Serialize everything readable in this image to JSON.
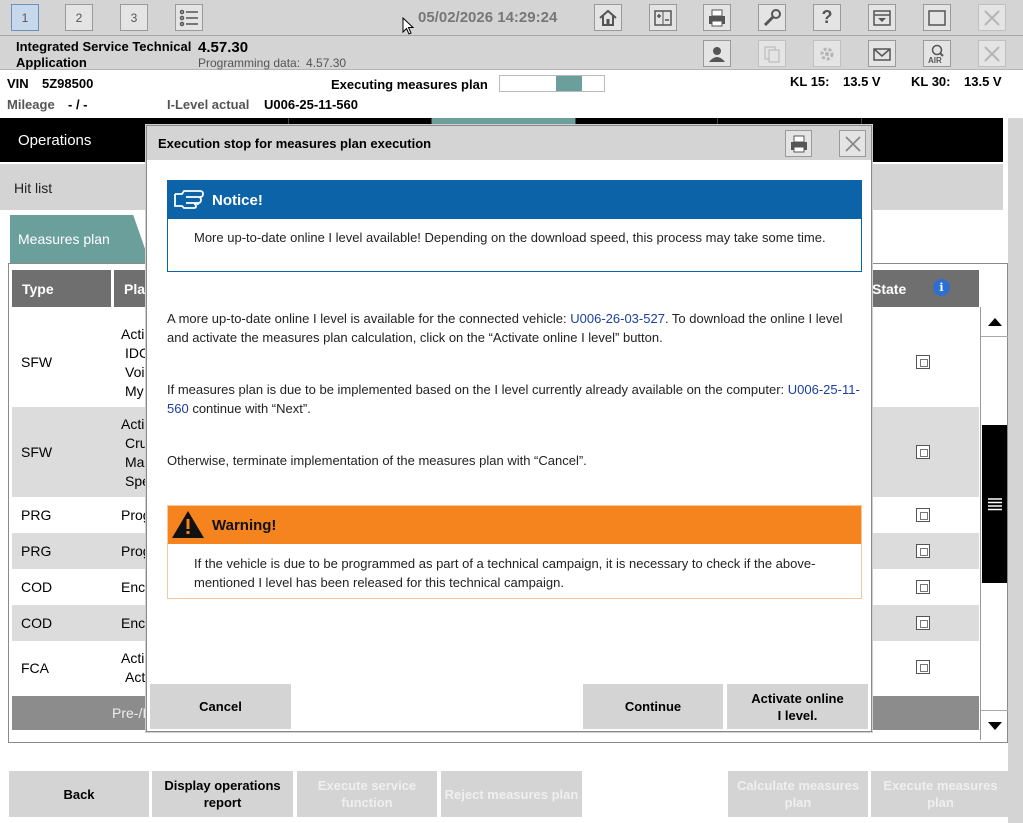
{
  "toolbar": {
    "tab1": "1",
    "tab2": "2",
    "tab3": "3",
    "datetime": "05/02/2026 14:29:24"
  },
  "header": {
    "app_name": "Integrated Service Technical Application",
    "version": "4.57.30",
    "programming_data_label": "Programming data:",
    "programming_data_value": "4.57.30"
  },
  "vehicle": {
    "vin_label": "VIN",
    "vin": "5Z98500",
    "mileage_label": "Mileage",
    "mileage": "- / -",
    "ilevel_label": "I-Level actual",
    "ilevel": "U006-25-11-560",
    "executing_label": "Executing measures plan",
    "kl15_label": "KL 15:",
    "kl15": "13.5 V",
    "kl30_label": "KL 30:",
    "kl30": "13.5 V"
  },
  "nav": {
    "operations": "Operations",
    "hit_list": "Hit list",
    "measures_plan": "Measures plan"
  },
  "table": {
    "columns": {
      "type": "Type",
      "plan": "Pla",
      "state": "State"
    },
    "rows": [
      {
        "type": "SFW",
        "lines": [
          "Acti",
          "IDC",
          "Voi",
          "My"
        ]
      },
      {
        "type": "SFW",
        "lines": [
          "Acti",
          "Cru",
          "Ma",
          "Spe"
        ]
      },
      {
        "type": "PRG",
        "lines": [
          "Prog"
        ]
      },
      {
        "type": "PRG",
        "lines": [
          "Prog"
        ]
      },
      {
        "type": "COD",
        "lines": [
          "Enc"
        ]
      },
      {
        "type": "COD",
        "lines": [
          "Enc"
        ]
      },
      {
        "type": "FCA",
        "lines": [
          "Acti",
          "Act"
        ]
      }
    ],
    "pre_row": "Pre-/I"
  },
  "bottom_buttons": {
    "back": "Back",
    "display_report": "Display operations report",
    "execute_service": "Execute service function",
    "reject_plan": "Reject measures plan",
    "calculate_plan": "Calculate measures plan",
    "execute_plan": "Execute measures plan"
  },
  "dialog": {
    "title": "Execution stop for measures plan execution",
    "notice_title": "Notice!",
    "notice_text": "More up-to-date online I level available! Depending on the download speed, this process may take some time.",
    "p1_before": "A more up-to-date online I level is available for the connected vehicle: ",
    "p1_link": "U006-26-03-527",
    "p1_after": ". To download the online I level and activate the measures plan calculation, click on the “Activate online I level” button.",
    "p2_before": "If measures plan is due to be implemented based on the I level currently already available on the computer: ",
    "p2_link": "U006-25-11-560",
    "p2_after": " continue with “Next”.",
    "p3": "Otherwise, terminate implementation of the measures plan with “Cancel”.",
    "warning_title": "Warning!",
    "warning_text": "If the vehicle is due to be programmed as part of a technical campaign, it is necessary to check if the above-mentioned I level has been released for this technical campaign.",
    "cancel": "Cancel",
    "continue": "Continue",
    "activate": "Activate online I level."
  },
  "colors": {
    "notice": "#0d63a8",
    "warning": "#f5841f",
    "teal": "#6a9f9b",
    "link": "#1a3fa0"
  }
}
